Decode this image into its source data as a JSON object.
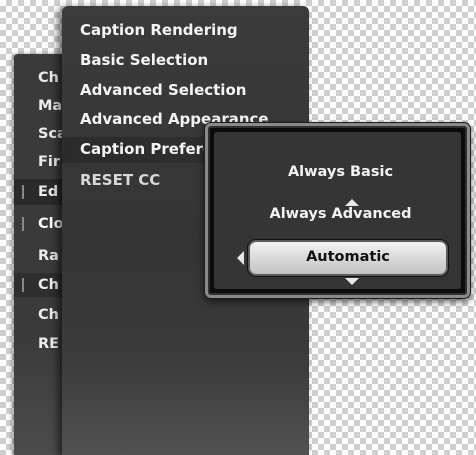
{
  "back_menu": {
    "items": [
      "Ch",
      "Ma",
      "Sca",
      "Fir",
      "Ed",
      "Clo",
      "Ra",
      "Ch",
      "Ch",
      "RE"
    ]
  },
  "submenu": {
    "items": [
      "Caption Rendering",
      "Basic Selection",
      "Advanced Selection",
      "Advanced Appearance",
      "Caption Preferences",
      "RESET CC"
    ],
    "selected_index": 4
  },
  "popup": {
    "options": [
      "Always Basic",
      "Always Advanced",
      "Automatic"
    ],
    "selected": "Automatic"
  },
  "icons": {
    "up": "chevron-up-icon",
    "down": "chevron-down-icon",
    "left": "chevron-left-icon"
  },
  "colors": {
    "menu_bg": "#353535",
    "popup_border": "#8a8a8a",
    "selected_button": "#d9d9d9"
  }
}
